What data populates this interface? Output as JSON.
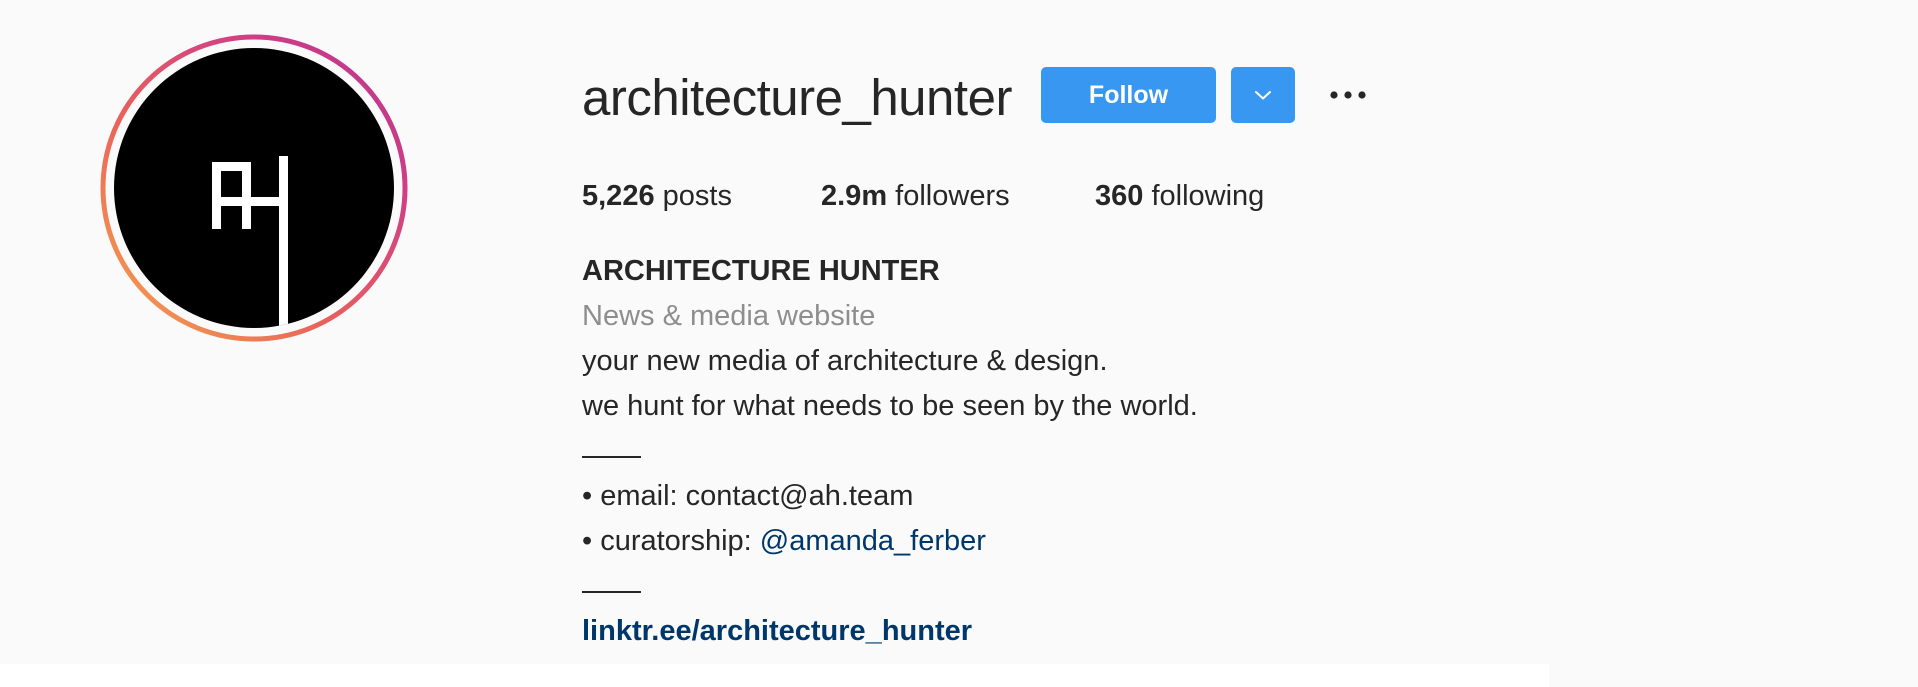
{
  "profile": {
    "username": "architecture_hunter",
    "avatar_label": "AH",
    "follow_label": "Follow"
  },
  "stats": {
    "posts_count": "5,226",
    "posts_label": "posts",
    "followers_count": "2.9m",
    "followers_label": "followers",
    "following_count": "360",
    "following_label": "following"
  },
  "bio": {
    "full_name": "ARCHITECTURE HUNTER",
    "category": "News & media website",
    "line1": "your new media of architecture & design.",
    "line2": "we hunt for what needs to be seen by the world.",
    "email_prefix": "• email: ",
    "email_value": "contact@ah.team",
    "curator_prefix": "• curatorship: ",
    "curator_mention": "@amanda_ferber",
    "link": "linktr.ee/architecture_hunter"
  },
  "icons": {
    "dropdown": "chevron-down-icon",
    "more": "more-options-icon"
  },
  "colors": {
    "accent": "#3897f0",
    "link": "#00376b",
    "secondary_text": "#8e8e8e",
    "background": "#fafafa"
  }
}
